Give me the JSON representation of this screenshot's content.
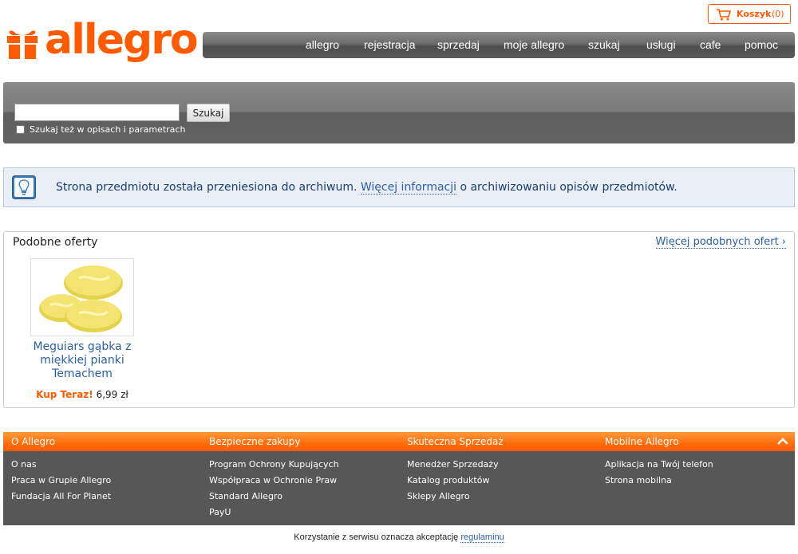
{
  "brand": {
    "name": "allegro",
    "color": "#ff5a00"
  },
  "cart": {
    "label": "Koszyk",
    "count": "(0)"
  },
  "nav": {
    "items": [
      {
        "label": "allegro"
      },
      {
        "label": "rejestracja"
      },
      {
        "label": "sprzedaj"
      },
      {
        "label": "moje allegro"
      },
      {
        "label": "szukaj"
      },
      {
        "label": "usługi"
      },
      {
        "label": "cafe"
      },
      {
        "label": "pomoc"
      }
    ]
  },
  "search": {
    "value": "",
    "button": "Szukaj",
    "checkbox_label": "Szukaj też w opisach i parametrach",
    "checkbox_checked": false
  },
  "info": {
    "text_before": "Strona przedmiotu została przeniesiona do archiwum. ",
    "link": "Więcej informacji",
    "text_after": " o archiwizowaniu opisów przedmiotów."
  },
  "similar": {
    "title": "Podobne oferty",
    "more_link": "Więcej podobnych ofert ›",
    "products": [
      {
        "title": "Meguiars gąbka z miękkiej pianki Temachem",
        "buy_label": "Kup Teraz!",
        "price": "6,99 zł"
      }
    ]
  },
  "footer": {
    "columns": [
      {
        "heading": "O Allegro",
        "links": [
          "O nas",
          "Praca w Grupie Allegro",
          "Fundacja All For Planet"
        ]
      },
      {
        "heading": "Bezpieczne zakupy",
        "links": [
          "Program Ochrony Kupujących",
          "Współpraca w Ochronie Praw",
          "Standard Allegro",
          "PayU"
        ]
      },
      {
        "heading": "Skuteczna Sprzedaż",
        "links": [
          "Menedżer Sprzedaży",
          "Katalog produktów",
          "Sklepy Allegro"
        ]
      },
      {
        "heading": "Mobilne Allegro",
        "links": [
          "Aplikacja na Twój telefon",
          "Strona mobilna"
        ]
      }
    ],
    "collapse_icon": "chevron-up-icon"
  },
  "terms": {
    "text": "Korzystanie z serwisu oznacza akceptację ",
    "link": "regulaminu"
  }
}
